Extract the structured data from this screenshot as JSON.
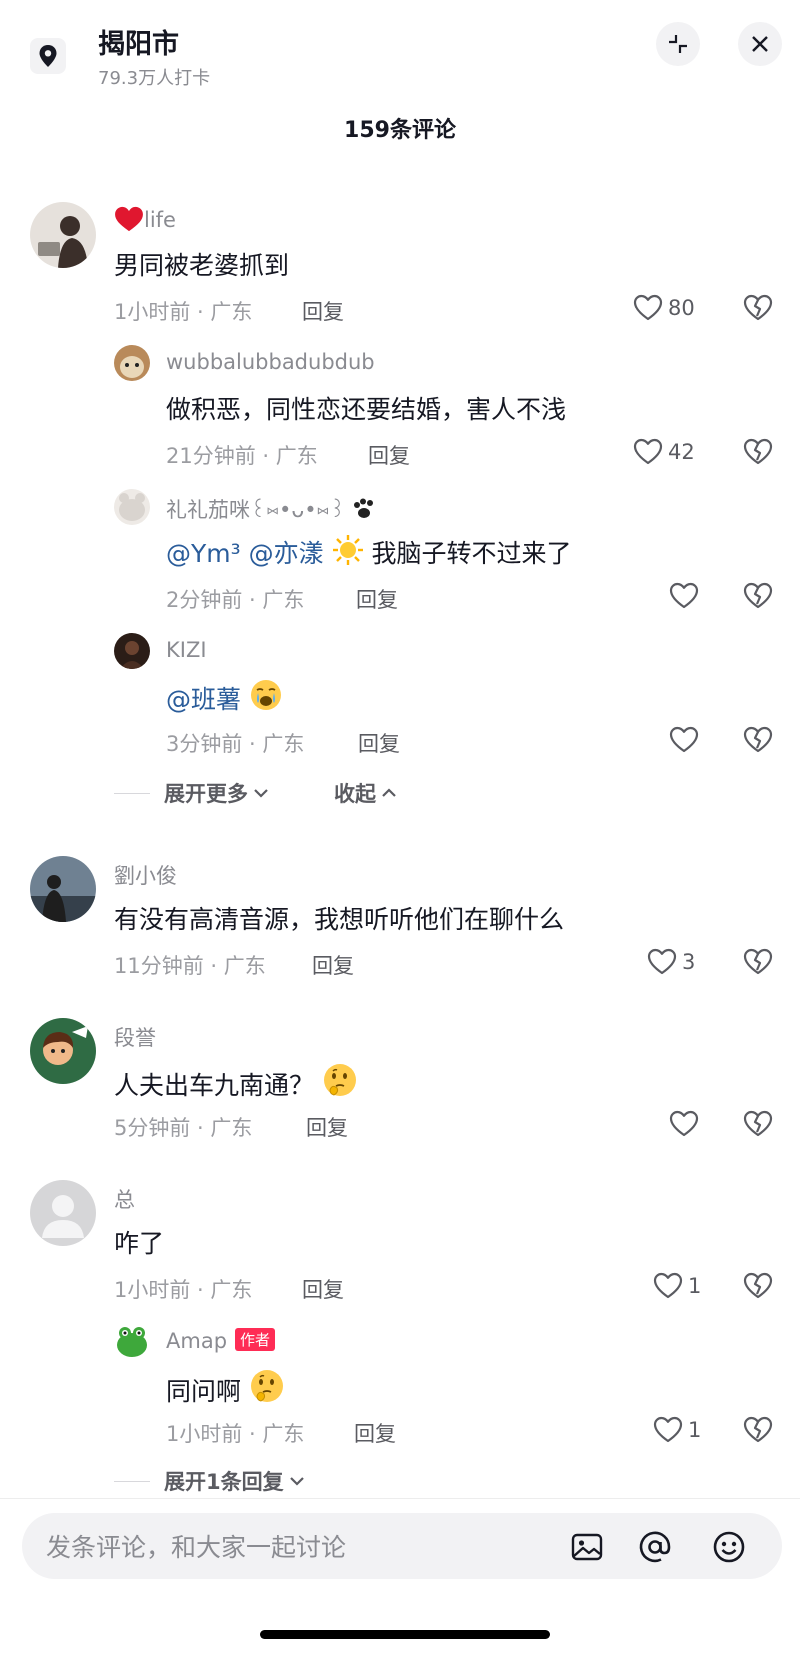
{
  "header": {
    "location_icon": "location-pin-icon",
    "title": "揭阳市",
    "subtitle": "79.3万人打卡",
    "collapse_icon": "collapse-icon",
    "close_icon": "close-icon",
    "comment_count": "159条评论"
  },
  "comments": [
    {
      "name": "life",
      "name_prefix_icon": "red-heart-icon",
      "text": "男同被老婆抓到",
      "time_loc": "1小时前 · 广东",
      "reply": "回复",
      "likes": "80",
      "replies": [
        {
          "name": "wubbalubbadubdub",
          "text": "做积恶，同性恋还要结婚，害人不浅",
          "time_loc": "21分钟前 · 广东",
          "reply": "回复",
          "likes": "42"
        },
        {
          "name": "礼礼茄咪꒰⑅•ᴗ•⑅꒱",
          "name_suffix_icon": "paw-icon",
          "mention1": "@Ym³",
          "mention2": "@亦漾",
          "emoji": "sun-emoji",
          "text": "我脑子转不过来了",
          "time_loc": "2分钟前 · 广东",
          "reply": "回复",
          "likes": ""
        },
        {
          "name": "KIZI",
          "mention1": "@班薯",
          "emoji": "crying-face-emoji",
          "time_loc": "3分钟前 · 广东",
          "reply": "回复",
          "likes": ""
        }
      ],
      "expand_more": "展开更多",
      "collapse": "收起"
    },
    {
      "name": "劉小俊",
      "text": "有没有高清音源，我想听听他们在聊什么",
      "time_loc": "11分钟前 · 广东",
      "reply": "回复",
      "likes": "3"
    },
    {
      "name": "段誉",
      "text": "人夫出车九南通？",
      "emoji": "thinking-face-emoji",
      "time_loc": "5分钟前 · 广东",
      "reply": "回复",
      "likes": ""
    },
    {
      "name": "总",
      "text": "咋了",
      "time_loc": "1小时前 · 广东",
      "reply": "回复",
      "likes": "1",
      "replies": [
        {
          "name": "Amap",
          "badge": "作者",
          "text": "同问啊",
          "emoji": "thinking-face-emoji",
          "time_loc": "1小时前 · 广东",
          "reply": "回复",
          "likes": "1"
        }
      ],
      "expand_more": "展开1条回复"
    }
  ],
  "input": {
    "placeholder": "发条评论，和大家一起讨论",
    "image_icon": "image-icon",
    "at_icon": "at-icon",
    "emoji_icon": "smiley-icon"
  },
  "colors": {
    "mention": "#2a5c9a",
    "badge": "#fe2c55",
    "text_primary": "#161823",
    "text_secondary": "#8a8b91"
  }
}
